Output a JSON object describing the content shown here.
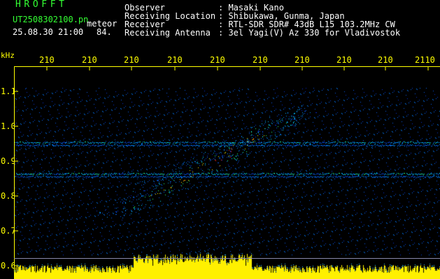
{
  "header": {
    "brand": "HROFFT",
    "filename": "UT2508302100.pn",
    "meteor_label": "meteor",
    "datetime": "25.08.30 21:00",
    "count": "84."
  },
  "info": [
    {
      "key": "Observer",
      "value": ": Masaki Kano"
    },
    {
      "key": "Receiving Location",
      "value": ": Shibukawa, Gunma, Japan"
    },
    {
      "key": "Receiver",
      "value": ": RTL-SDR SDR# 43dB L15 103.2MHz CW"
    },
    {
      "key": "Receiving Antenna",
      "value": ": 3el Yagi(V) Az 330 for Vladivostok"
    }
  ],
  "chart_data": {
    "type": "heatmap",
    "y_unit_label": "kHz",
    "x_tick_labels": [
      "210",
      "210",
      "210",
      "210",
      "210",
      "210",
      "210",
      "210",
      "210",
      "2110"
    ],
    "y_tick_labels": [
      "1.1",
      "1.0",
      "0.9",
      "0.8",
      "0.7",
      "0.6"
    ],
    "y_ticks": [
      1.1,
      1.0,
      0.9,
      0.8,
      0.7,
      0.6
    ],
    "ylim": [
      0.6,
      1.1
    ],
    "horizontal_lines_khz": [
      0.955,
      0.865
    ],
    "meteor_trail": {
      "x_start": 2104.2,
      "x_end": 2107.3,
      "y_start": 0.76,
      "y_end": 1.05
    },
    "colors": {
      "background": "#000000",
      "axis_text": "#ffff00",
      "header_text": "#33ff33",
      "noise_low": "#0a2cff",
      "noise_mid": "#00ffff",
      "trail_high": "#ff2020"
    }
  }
}
